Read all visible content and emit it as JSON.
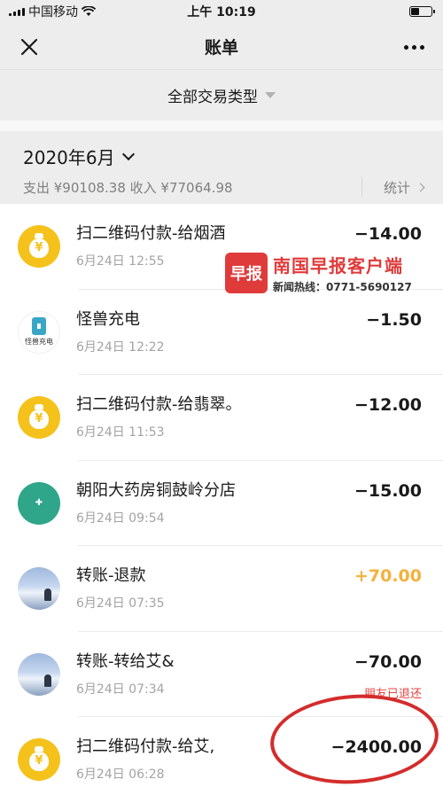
{
  "status_bar": {
    "carrier": "中国移动",
    "time": "上午 10:19"
  },
  "nav": {
    "title": "账单"
  },
  "filter": {
    "label": "全部交易类型"
  },
  "month": {
    "label": "2020年6月",
    "summary": "支出 ¥90108.38 收入 ¥77064.98",
    "stats_label": "统计"
  },
  "watermark": {
    "logo": "早报",
    "title": "南国早报客户端",
    "phone": "新闻热线：0771-5690127"
  },
  "transactions": [
    {
      "title": "扫二维码付款-给烟酒",
      "time": "6月24日 12:55",
      "amount": "−14.00",
      "icon": "money-bag-icon"
    },
    {
      "title": "怪兽充电",
      "time": "6月24日 12:22",
      "amount": "−1.50",
      "icon": "charger-icon",
      "icon_caption": "怪兽充电"
    },
    {
      "title": "扫二维码付款-给翡翠。",
      "time": "6月24日 11:53",
      "amount": "−12.00",
      "icon": "money-bag-icon"
    },
    {
      "title": "朝阳大药房铜鼓岭分店",
      "time": "6月24日 09:54",
      "amount": "−15.00",
      "icon": "pharmacy-icon"
    },
    {
      "title": "转账-退款",
      "time": "6月24日 07:35",
      "amount": "+70.00",
      "icon": "avatar"
    },
    {
      "title": "转账-转给艾&",
      "time": "6月24日 07:34",
      "amount": "−70.00",
      "icon": "avatar",
      "note": "朋友已退还"
    },
    {
      "title": "扫二维码付款-给艾,",
      "time": "6月24日 06:28",
      "amount": "−2400.00",
      "icon": "money-bag-icon"
    }
  ],
  "colors": {
    "income": "#f4b13c",
    "note_red": "#e64340",
    "brand_yellow": "#f4c21b",
    "annotation": "#d42c2c"
  }
}
